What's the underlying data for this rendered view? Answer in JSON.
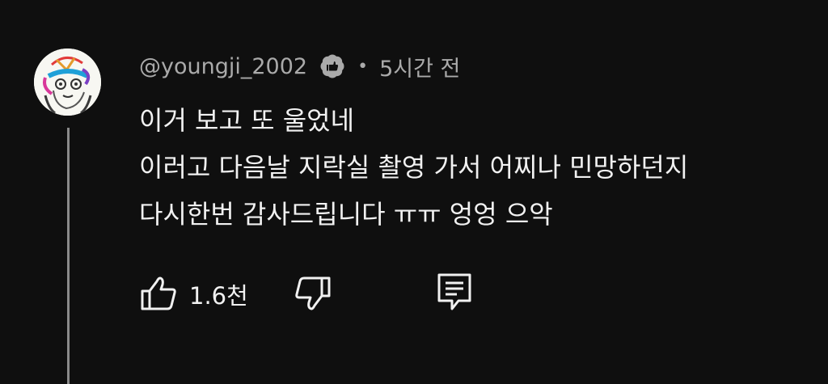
{
  "comment": {
    "username": "@youngji_2002",
    "time": "5시간 전",
    "lines": [
      "이거 보고 또 울었네",
      "이러고 다음날 지락실 촬영 가서 어찌나 민망하던지",
      "다시한번 감사드립니다 ㅠㅠ 엉엉 으악"
    ],
    "like_count": "1.6천"
  },
  "icons": {
    "avatar": "avatar",
    "badge": "creator-heart-badge-icon",
    "like": "thumbs-up-icon",
    "dislike": "thumbs-down-icon",
    "reply": "reply-icon"
  },
  "colors": {
    "background": "#0f0f0f",
    "text": "#f1f1f1",
    "secondary": "#aaaaaa"
  }
}
